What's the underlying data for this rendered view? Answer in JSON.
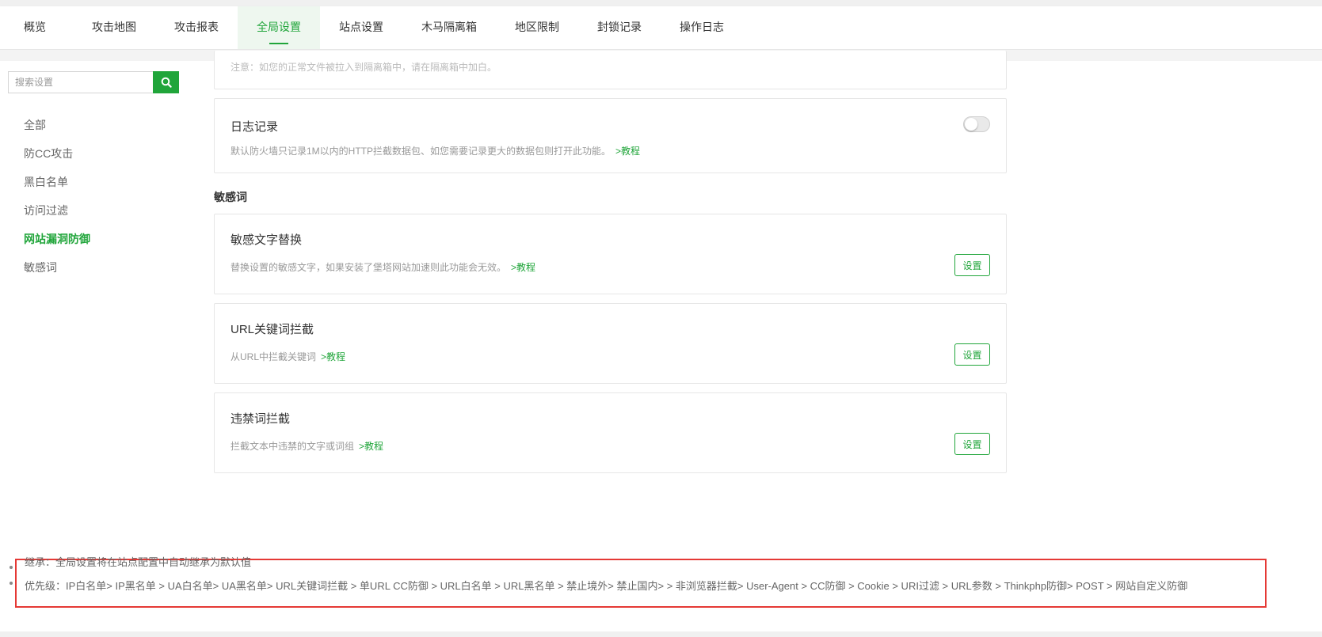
{
  "tabs": [
    {
      "label": "概览"
    },
    {
      "label": "攻击地图"
    },
    {
      "label": "攻击报表"
    },
    {
      "label": "全局设置",
      "active": true
    },
    {
      "label": "站点设置"
    },
    {
      "label": "木马隔离箱"
    },
    {
      "label": "地区限制"
    },
    {
      "label": "封锁记录"
    },
    {
      "label": "操作日志"
    }
  ],
  "search": {
    "placeholder": "搜索设置",
    "value": ""
  },
  "sidebar": {
    "items": [
      {
        "label": "全部"
      },
      {
        "label": "防CC攻击"
      },
      {
        "label": "黑白名单"
      },
      {
        "label": "访问过滤"
      },
      {
        "label": "网站漏洞防御",
        "active": true
      },
      {
        "label": "敏感词"
      }
    ]
  },
  "cards": {
    "quarantine_note": {
      "desc": "注意：如您的正常文件被拉入到隔离箱中，请在隔离箱中加白。"
    },
    "log": {
      "title": "日志记录",
      "desc": "默认防火墙只记录1M以内的HTTP拦截数据包、如您需要记录更大的数据包则打开此功能。",
      "link": ">教程",
      "enabled": false
    },
    "section_title": "敏感词",
    "sensitive_replace": {
      "title": "敏感文字替换",
      "desc": "替换设置的敏感文字，如果安装了堡塔网站加速则此功能会无效。",
      "link": ">教程",
      "button": "设置"
    },
    "url_keyword": {
      "title": "URL关键词拦截",
      "desc": "从URL中拦截关键词",
      "link": ">教程",
      "button": "设置"
    },
    "forbidden_words": {
      "title": "违禁词拦截",
      "desc": "拦截文本中违禁的文字或词组",
      "link": ">教程",
      "button": "设置"
    }
  },
  "notes": {
    "inherit": "继承：全局设置将在站点配置中自动继承为默认值",
    "priority": "优先级：IP白名单> IP黑名单 > UA白名单> UA黑名单> URL关键词拦截 > 单URL CC防御 > URL白名单 > URL黑名单 > 禁止境外> 禁止国内> > 非浏览器拦截> User-Agent > CC防御 > Cookie > URI过滤 > URL参数 > Thinkphp防御> POST > 网站自定义防御"
  },
  "colors": {
    "accent": "#20a53a",
    "highlight_border": "#e53935"
  },
  "icons": {
    "search": "search-icon"
  }
}
